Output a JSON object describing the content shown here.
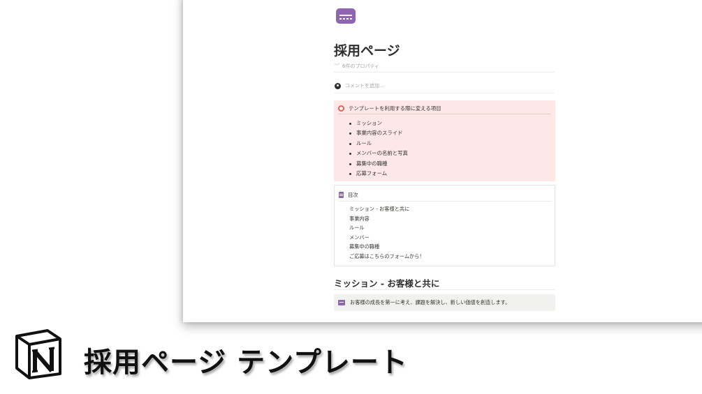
{
  "page": {
    "icon": "credit-card-icon",
    "title": "採用ページ",
    "properties_toggle": "6件のプロパティ",
    "comment_placeholder": "コメントを追加..."
  },
  "callout": {
    "icon": "alarm-icon",
    "heading": "テンプレートを利用する際に変える項目",
    "items": [
      "ミッション",
      "事業内容のスライド",
      "ルール",
      "メンバーの名前と写真",
      "募集中の職種",
      "応募フォーム"
    ]
  },
  "toc": {
    "icon": "document-icon",
    "heading": "目次",
    "items": [
      "ミッション - お客様と共に",
      "事業内容",
      "ルール",
      "メンバー",
      "募集中の職種",
      "ご応募はこちらのフォームから！"
    ]
  },
  "section": {
    "heading": "ミッション - お客様と共に",
    "callout_icon": "mail-icon",
    "callout_text": "お客様の成長を第一に考え、課題を解決し、新しい価値を創造します。"
  },
  "banner": {
    "logo": "notion-logo",
    "title": "採用ページ テンプレート",
    "logo_color": "#111111"
  },
  "colors": {
    "callout_bg": "#fde8e7",
    "accent_purple": "#9065b0",
    "alarm_red": "#e16259",
    "gray_callout_bg": "#f1f1ef"
  }
}
